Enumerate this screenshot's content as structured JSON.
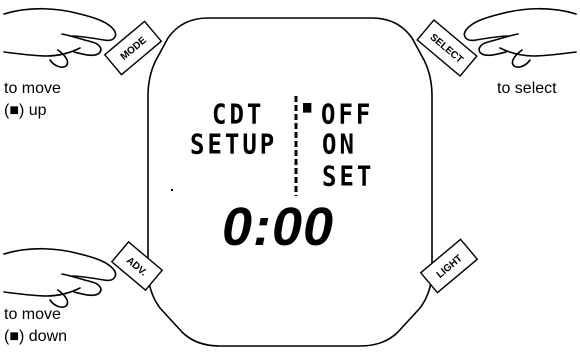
{
  "buttons": {
    "mode": "MODE",
    "select": "SELECT",
    "adv": "ADV.",
    "light": "LIGHT"
  },
  "captions": {
    "move_up": "to move\n(■) up",
    "select": "to select",
    "move_down": "to move\n(■) down"
  },
  "display": {
    "title_line1": "CDT",
    "title_line2": "SETUP",
    "options": [
      "OFF",
      "ON",
      "SET"
    ],
    "cursor": "■",
    "time": "0:00"
  },
  "icons": {
    "hand": "pointing-hand-icon",
    "button": "button-icon"
  },
  "colors": {
    "ink": "#000000",
    "background": "#ffffff"
  }
}
